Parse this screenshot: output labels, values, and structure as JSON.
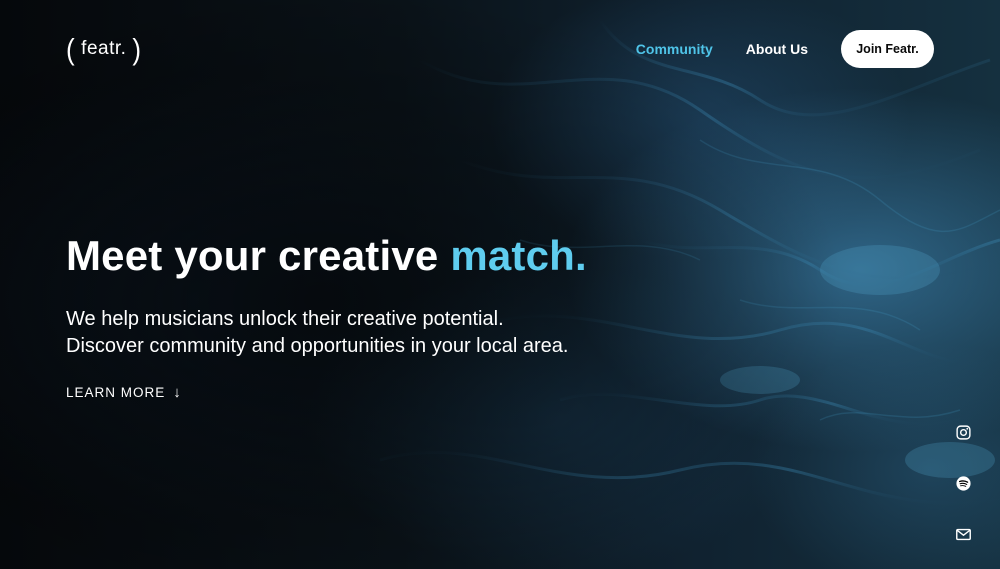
{
  "brand": {
    "logo_text": "featr.",
    "paren_left": "(",
    "paren_right": ")"
  },
  "nav": {
    "items": [
      {
        "label": "Community",
        "active": true
      },
      {
        "label": "About Us",
        "active": false
      }
    ],
    "cta_label": "Join Featr."
  },
  "hero": {
    "headline_main": "Meet your creative ",
    "headline_accent": "match.",
    "subhead_line1": "We help musicians unlock their creative potential.",
    "subhead_line2": "Discover community and opportunities in your local area.",
    "learn_more_label": "LEARN MORE",
    "learn_more_arrow": "↓"
  },
  "social": {
    "icons": [
      "instagram-icon",
      "spotify-icon",
      "mail-icon"
    ]
  },
  "colors": {
    "accent": "#5fcdef",
    "nav_active": "#4fc4e8",
    "button_bg": "#ffffff",
    "button_text": "#0a0a0a"
  }
}
